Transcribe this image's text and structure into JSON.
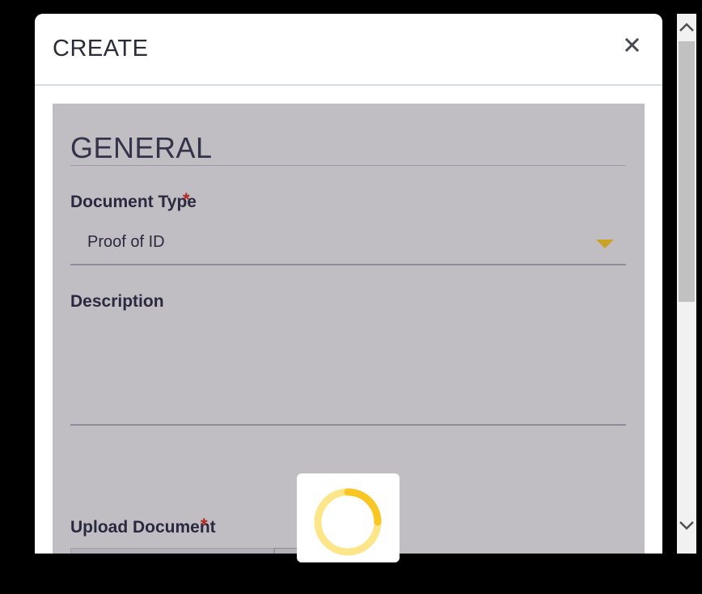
{
  "modal": {
    "title": "CREATE",
    "close_icon": "close-icon"
  },
  "general": {
    "section_title": "GENERAL",
    "document_type": {
      "label": "Document Type",
      "required_mark": "*",
      "value": "Proof of ID",
      "caret_icon": "triangle-down-icon"
    },
    "description": {
      "label": "Description",
      "value": ""
    },
    "upload_document": {
      "label": "Upload Document",
      "required_mark": "*"
    }
  },
  "loader": {
    "icon": "spinner-icon"
  },
  "colors": {
    "panel_bg": "#c0bec3",
    "accent_caret": "#c9a227",
    "required": "#b3261e",
    "spinner": "#f9c623",
    "spinner_track": "#fde68a"
  }
}
